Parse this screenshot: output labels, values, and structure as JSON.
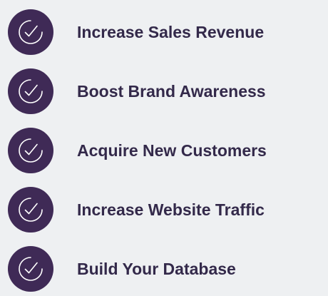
{
  "colors": {
    "background": "#eef0f2",
    "badge": "#3f2a56",
    "text": "#33294a",
    "icon": "#ffffff"
  },
  "icon": "check-circle-icon",
  "items": [
    {
      "label": "Increase Sales Revenue"
    },
    {
      "label": "Boost Brand Awareness"
    },
    {
      "label": "Acquire New Customers"
    },
    {
      "label": "Increase Website Traffic"
    },
    {
      "label": "Build Your Database"
    }
  ]
}
